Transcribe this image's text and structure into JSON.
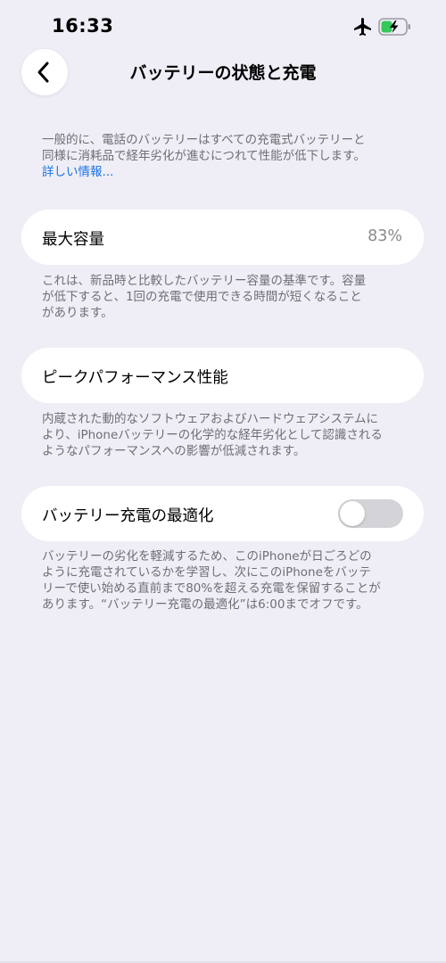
{
  "status_bar": {
    "time": "16:33",
    "icons": [
      "airplane-icon",
      "battery-charging-icon"
    ]
  },
  "nav": {
    "back_icon": "chevron-left-icon",
    "title": "バッテリーの状態と充電"
  },
  "intro": {
    "line1": "一般的に、電話のバッテリーはすべての充電式バッテリーと",
    "line2": "同様に消耗品で経年劣化が進むにつれて性能が低下します。",
    "link": "詳しい情報..."
  },
  "max_capacity": {
    "label": "最大容量",
    "value": "83%",
    "desc_line1": "これは、新品時と比較したバッテリー容量の基準です。容量",
    "desc_line2": "が低下すると、1回の充電で使用できる時間が短くなること",
    "desc_line3": "があります。"
  },
  "peak_performance": {
    "label": "ピークパフォーマンス性能",
    "desc_line1": "内蔵された動的なソフトウェアおよびハードウェアシステムに",
    "desc_line2": "より、iPhoneバッテリーの化学的な経年劣化として認識される",
    "desc_line3": "ようなパフォーマンスへの影響が低減されます。"
  },
  "optimized_charging": {
    "label": "バッテリー充電の最適化",
    "enabled": false,
    "desc_line1": "バッテリーの劣化を軽減するため、このiPhoneが日ごろどの",
    "desc_line2": "ように充電されているかを学習し、次にこのiPhoneをバッテ",
    "desc_line3": "リーで使い始める直前まで80%を超える充電を保留することが",
    "desc_line4": "あります。“バッテリー充電の最適化”は6:00までオフです。"
  },
  "colors": {
    "background": "#efeef6",
    "card": "#ffffff",
    "link": "#1a73e8",
    "secondary_text": "#6e6e73",
    "toggle_off": "#d4d4d8",
    "battery_green": "#34c759"
  }
}
